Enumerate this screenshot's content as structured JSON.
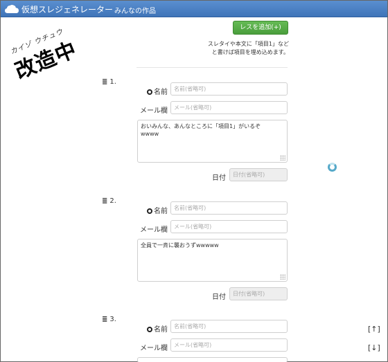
{
  "navbar": {
    "brand": "仮想スレジェネレーター",
    "link": "みんなの作品",
    "icon": "cloud-icon"
  },
  "stamp": {
    "ruby": "カイゾ ウチュウ",
    "main": "改造中"
  },
  "toolbar": {
    "add_label": "レスを追加(+)",
    "hint_line1": "スレタイや本文に「項目1」など",
    "hint_line2": "と書けば項目を埋め込めます。"
  },
  "form_labels": {
    "name": "名前",
    "mail": "メール欄",
    "date": "日付",
    "name_placeholder": "名前(省略可)",
    "mail_placeholder": "メール(省略可)",
    "date_placeholder": "日付(省略可)"
  },
  "posts": [
    {
      "number": "1.",
      "body_line1": "おいみんな、あんなところに「項目1」がいるぞ",
      "body_line2": "wwww"
    },
    {
      "number": "2.",
      "body_line1": "全員で一斉に襲おうずwwwww",
      "body_line2": ""
    },
    {
      "number": "3.",
      "body_line1": "",
      "body_line2": ""
    }
  ],
  "scroll": {
    "up": "[↑]",
    "down": "[↓]"
  }
}
